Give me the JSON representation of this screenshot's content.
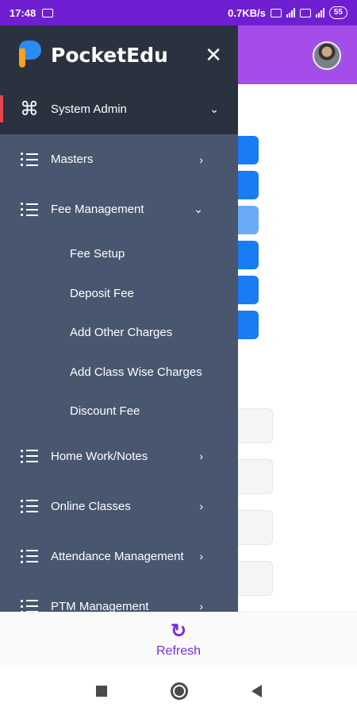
{
  "status_bar": {
    "time": "17:48",
    "speed": "0.7KB/s",
    "battery": "55"
  },
  "drawer": {
    "app_title": "PocketEdu",
    "close_glyph": "✕",
    "active_item": {
      "label": "System Admin",
      "icon": "command-icon",
      "chevron": "⌄"
    },
    "items_top": [
      {
        "label": "Masters",
        "chevron": "›"
      },
      {
        "label": "Fee Management",
        "chevron": "⌄"
      }
    ],
    "sub_items": [
      "Fee Setup",
      "Deposit Fee",
      "Add Other Charges",
      "Add Class Wise Charges",
      "Discount Fee"
    ],
    "items_bottom": [
      {
        "label": "Home Work/Notes",
        "chevron": "›"
      },
      {
        "label": "Online Classes",
        "chevron": "›"
      },
      {
        "label": "Attendance Management",
        "chevron": "›"
      },
      {
        "label": "PTM Management",
        "chevron": "›"
      }
    ]
  },
  "bottom_bar": {
    "refresh_icon": "↻",
    "refresh_label": "Refresh"
  },
  "colors": {
    "status_bar": "#6f1fd1",
    "header": "#a54de8",
    "drawer": "#48566f",
    "drawer_dark": "#2b323f",
    "active_accent": "#e8454d",
    "button_blue": "#1a7cf2",
    "refresh": "#7b2bd8"
  }
}
